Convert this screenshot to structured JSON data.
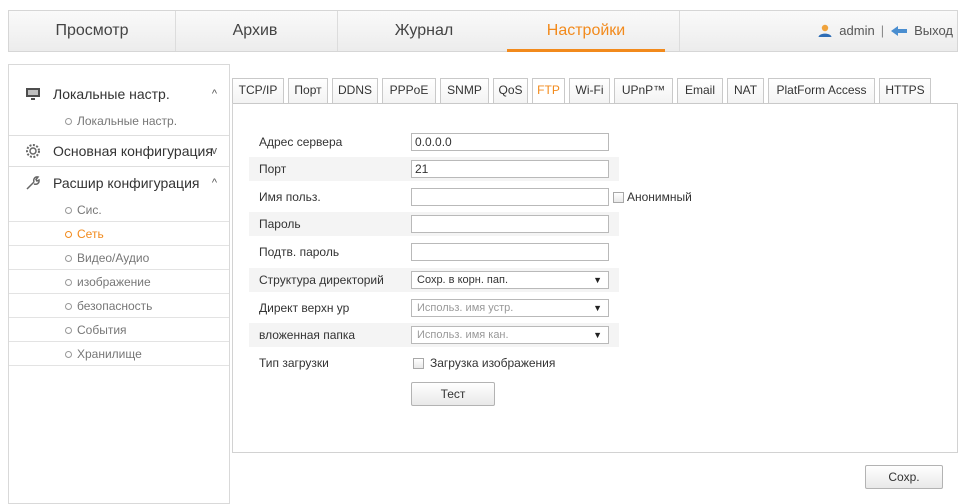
{
  "nav": {
    "tabs": [
      {
        "label": "Просмотр"
      },
      {
        "label": "Архив"
      },
      {
        "label": "Журнал"
      },
      {
        "label": "Настройки"
      }
    ],
    "user": "admin",
    "separator": "|",
    "logout": "Выход"
  },
  "sidebar": {
    "local": {
      "title": "Локальные настр.",
      "items": [
        "Локальные настр."
      ]
    },
    "basic": {
      "title": "Основная конфигурация"
    },
    "advanced": {
      "title": "Расшир конфигурация",
      "items": [
        "Сис.",
        "Сеть",
        "Видео/Аудио",
        "изображение",
        "безопасность",
        "События",
        "Хранилище"
      ]
    }
  },
  "subtabs": [
    "TCP/IP",
    "Порт",
    "DDNS",
    "PPPoE",
    "SNMP",
    "QoS",
    "FTP",
    "Wi-Fi",
    "UPnP™",
    "Email",
    "NAT",
    "PlatForm Access",
    "HTTPS"
  ],
  "form": {
    "server_address_label": "Адрес сервера",
    "server_address_value": "0.0.0.0",
    "port_label": "Порт",
    "port_value": "21",
    "username_label": "Имя польз.",
    "username_value": "",
    "anonymous_label": "Анонимный",
    "password_label": "Пароль",
    "confirm_password_label": "Подтв. пароль",
    "dir_structure_label": "Структура директорий",
    "dir_structure_value": "Сохр. в корн. пап.",
    "parent_dir_label": "Директ верхн ур",
    "parent_dir_value": "Использ. имя устр.",
    "child_dir_label": "вложенная папка",
    "child_dir_value": "Использ. имя кан.",
    "upload_type_label": "Тип загрузки",
    "upload_picture_label": "Загрузка изображения",
    "test_button": "Тест",
    "save_button": "Сохр."
  },
  "colors": {
    "accent": "#f28a1c"
  }
}
